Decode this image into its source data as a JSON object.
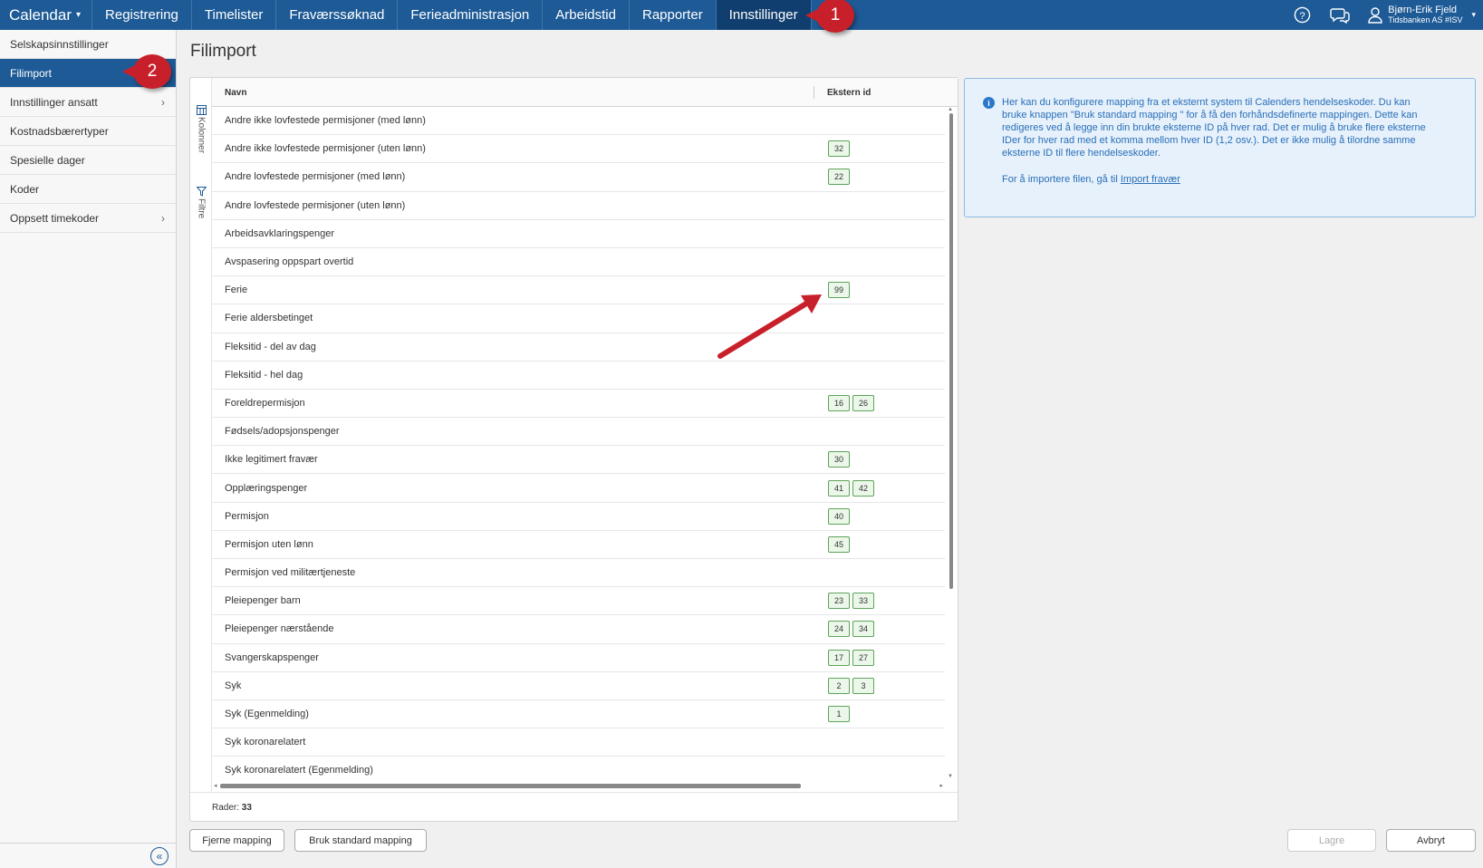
{
  "topnav": {
    "brand": "Calendar",
    "items": [
      {
        "label": "Registrering"
      },
      {
        "label": "Timelister"
      },
      {
        "label": "Fraværssøknad"
      },
      {
        "label": "Ferieadministrasjon"
      },
      {
        "label": "Arbeidstid"
      },
      {
        "label": "Rapporter"
      },
      {
        "label": "Innstillinger",
        "active": true
      }
    ],
    "help_icon": "help-circle-icon",
    "chat_icon": "chat-icon",
    "user": {
      "name": "Bjørn-Erik Fjeld",
      "org": "Tidsbanken AS #ISV",
      "icon": "user-icon"
    }
  },
  "sidebar": {
    "items": [
      {
        "label": "Selskapsinnstillinger"
      },
      {
        "label": "Filimport",
        "active": true
      },
      {
        "label": "Innstillinger ansatt",
        "has_children": true
      },
      {
        "label": "Kostnadsbærertyper"
      },
      {
        "label": "Spesielle dager"
      },
      {
        "label": "Koder"
      },
      {
        "label": "Oppsett timekoder",
        "has_children": true
      }
    ],
    "collapse_icon": "double-chevron-left-icon"
  },
  "page": {
    "title": "Filimport"
  },
  "grid": {
    "side_tools": {
      "columns": "Kolonner",
      "filters": "Filtre"
    },
    "columns": {
      "navn": "Navn",
      "ekstern": "Ekstern id"
    },
    "rows": [
      {
        "name": "Andre ikke lovfestede permisjoner (med lønn)",
        "ids": []
      },
      {
        "name": "Andre ikke lovfestede permisjoner (uten lønn)",
        "ids": [
          "32"
        ]
      },
      {
        "name": "Andre lovfestede permisjoner (med lønn)",
        "ids": [
          "22"
        ]
      },
      {
        "name": "Andre lovfestede permisjoner (uten lønn)",
        "ids": []
      },
      {
        "name": "Arbeidsavklaringspenger",
        "ids": []
      },
      {
        "name": "Avspasering oppspart overtid",
        "ids": []
      },
      {
        "name": "Ferie",
        "ids": [
          "99"
        ]
      },
      {
        "name": "Ferie aldersbetinget",
        "ids": []
      },
      {
        "name": "Fleksitid - del av dag",
        "ids": []
      },
      {
        "name": "Fleksitid - hel dag",
        "ids": []
      },
      {
        "name": "Foreldrepermisjon",
        "ids": [
          "16",
          "26"
        ]
      },
      {
        "name": "Fødsels/adopsjonspenger",
        "ids": []
      },
      {
        "name": "Ikke legitimert fravær",
        "ids": [
          "30"
        ]
      },
      {
        "name": "Opplæringspenger",
        "ids": [
          "41",
          "42"
        ]
      },
      {
        "name": "Permisjon",
        "ids": [
          "40"
        ]
      },
      {
        "name": "Permisjon uten lønn",
        "ids": [
          "45"
        ]
      },
      {
        "name": "Permisjon ved militærtjeneste",
        "ids": []
      },
      {
        "name": "Pleiepenger barn",
        "ids": [
          "23",
          "33"
        ]
      },
      {
        "name": "Pleiepenger nærstående",
        "ids": [
          "24",
          "34"
        ]
      },
      {
        "name": "Svangerskapspenger",
        "ids": [
          "17",
          "27"
        ]
      },
      {
        "name": "Syk",
        "ids": [
          "2",
          "3"
        ]
      },
      {
        "name": "Syk (Egenmelding)",
        "ids": [
          "1"
        ]
      },
      {
        "name": "Syk koronarelatert",
        "ids": []
      },
      {
        "name": "Syk koronarelatert (Egenmelding)",
        "ids": []
      }
    ],
    "footer": {
      "label": "Rader: ",
      "count": "33"
    }
  },
  "info": {
    "icon": "info-icon",
    "text": "Her kan du konfigurere mapping fra et eksternt system til Calenders hendelseskoder. Du kan bruke knappen \"Bruk standard mapping \" for å få den forhåndsdefinerte mappingen. Dette kan redigeres ved å legge inn din brukte eksterne ID på hver rad. Det er mulig å bruke flere eksterne IDer for hver rad med et komma mellom hver ID (1,2 osv.). Det er ikke mulig å tilordne samme eksterne ID til flere hendelseskoder.",
    "import_prefix": "For å importere filen, gå til ",
    "import_link": "Import fravær"
  },
  "buttons": {
    "remove_mapping": "Fjerne mapping",
    "standard_mapping": "Bruk standard mapping",
    "save": "Lagre",
    "cancel": "Avbryt"
  },
  "annotations": {
    "marker1": "1",
    "marker2": "2"
  },
  "colors": {
    "nav": "#1d5a96",
    "nav_active": "#103e6e",
    "badge_border": "#5ea35a",
    "annotation": "#c8202a"
  }
}
